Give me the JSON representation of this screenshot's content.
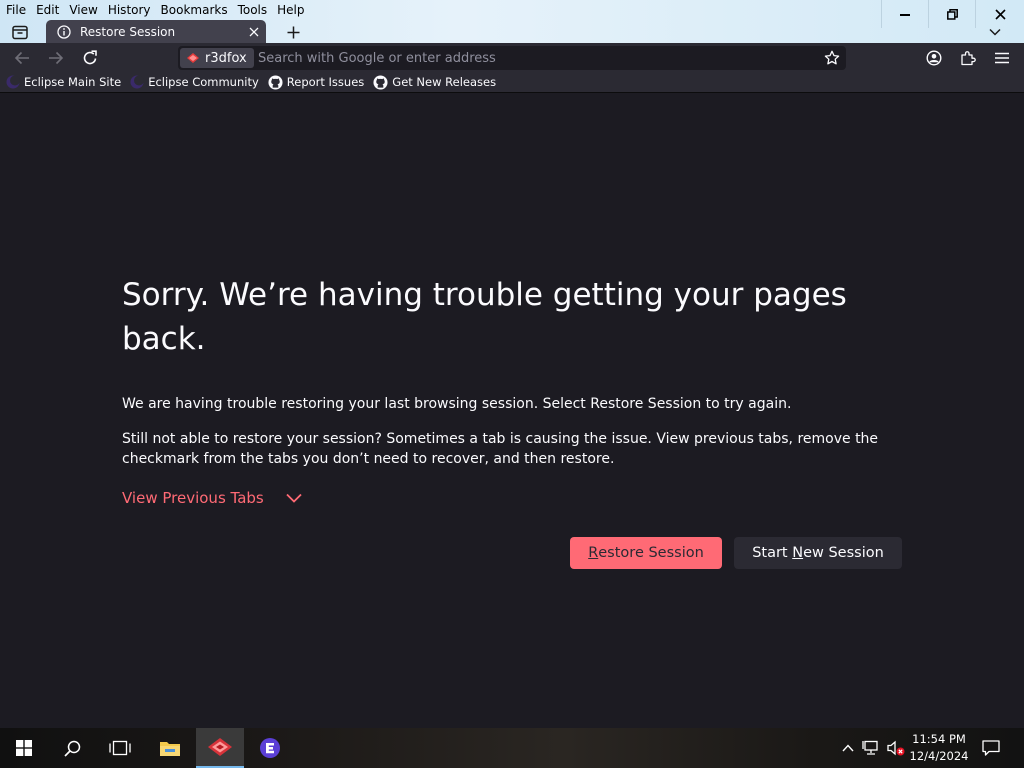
{
  "menubar": {
    "items": [
      {
        "label": "File"
      },
      {
        "label": "Edit"
      },
      {
        "label": "View"
      },
      {
        "label": "History"
      },
      {
        "label": "Bookmarks"
      },
      {
        "label": "Tools"
      },
      {
        "label": "Help"
      }
    ]
  },
  "tab": {
    "title": "Restore Session",
    "icon": "info-icon"
  },
  "urlbar": {
    "identity_label": "r3dfox",
    "placeholder": "Search with Google or enter address"
  },
  "bookmarks": [
    {
      "label": "Eclipse Main Site",
      "icon": "eclipse-icon"
    },
    {
      "label": "Eclipse Community",
      "icon": "eclipse-icon"
    },
    {
      "label": "Report Issues",
      "icon": "github-icon"
    },
    {
      "label": "Get New Releases",
      "icon": "github-icon"
    }
  ],
  "content": {
    "heading": "Sorry. We’re having trouble getting your pages back.",
    "paragraph1": "We are having trouble restoring your last browsing session. Select Restore Session to try again.",
    "paragraph2": "Still not able to restore your session? Sometimes a tab is causing the issue. View previous tabs, remove the checkmark from the tabs you don’t need to recover, and then restore.",
    "view_previous_tabs": "View Previous Tabs",
    "restore_button": {
      "access_key": "R",
      "rest": "estore Session"
    },
    "new_session_button": {
      "before": "Start ",
      "access_key": "N",
      "after": "ew Session"
    }
  },
  "colors": {
    "accent": "#ff6a75",
    "page_bg": "#1c1b22",
    "toolbar_bg": "#2b2a33"
  },
  "taskbar": {
    "clock_time": "11:54 PM",
    "clock_date": "12/4/2024"
  }
}
